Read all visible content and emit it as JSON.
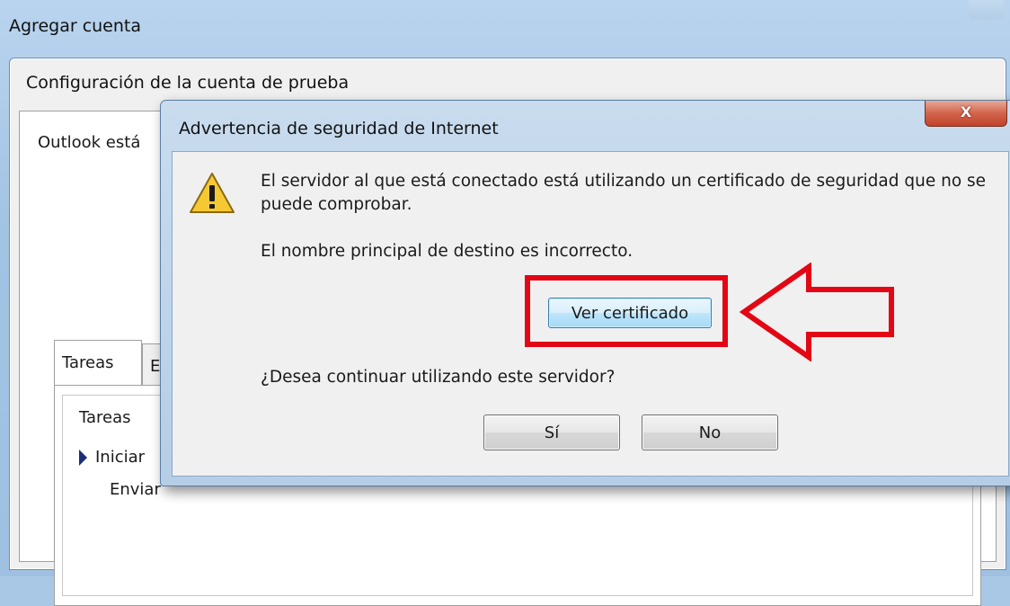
{
  "outer_window": {
    "title": "Agregar cuenta"
  },
  "inner_window": {
    "title": "Configuración de la cuenta de prueba",
    "status": "Outlook está",
    "tabs": [
      {
        "label": "Tareas"
      },
      {
        "label": "Er"
      }
    ],
    "tasks": {
      "header": "Tareas",
      "rows": [
        "Iniciar",
        "Enviar"
      ]
    }
  },
  "dialog": {
    "title": "Advertencia de seguridad de Internet",
    "close_label": "X",
    "message_line1": "El servidor al que está conectado está utilizando un certificado de seguridad que no se puede comprobar.",
    "message_line2": "El nombre principal de destino es incorrecto.",
    "view_cert_label": "Ver certificado",
    "question": "¿Desea continuar utilizando este servidor?",
    "yes_label": "Sí",
    "no_label": "No"
  },
  "annotation": {
    "highlight_color": "#e30614"
  },
  "icons": {
    "warning": "warning-icon",
    "close": "close-icon",
    "arrow": "arrow-right-icon"
  }
}
